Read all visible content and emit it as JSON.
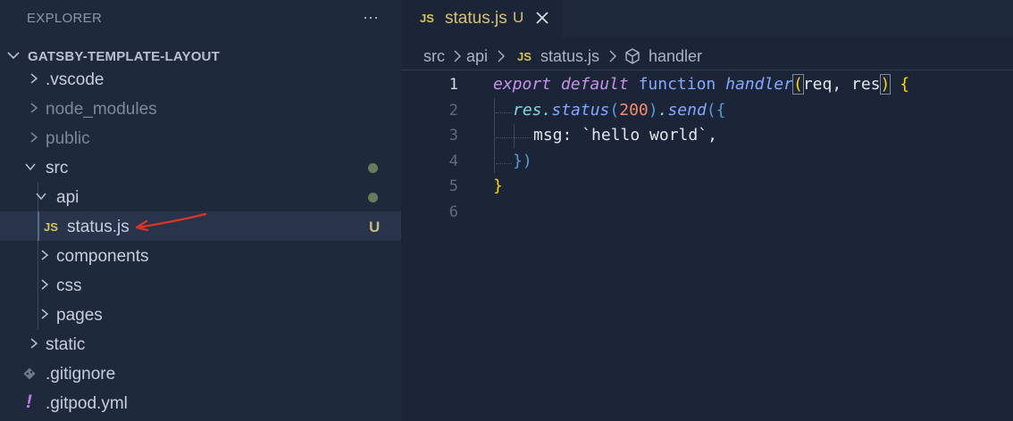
{
  "sidebar": {
    "title": "EXPLORER",
    "more_label": "···",
    "project_name": "GATSBY-TEMPLATE-LAYOUT",
    "items": [
      {
        "label": ".vscode"
      },
      {
        "label": "node_modules"
      },
      {
        "label": "public"
      },
      {
        "label": "src"
      },
      {
        "label": "api"
      },
      {
        "label": "status.js",
        "badge": "U",
        "icon_text": "JS"
      },
      {
        "label": "components"
      },
      {
        "label": "css"
      },
      {
        "label": "pages"
      },
      {
        "label": "static"
      },
      {
        "label": ".gitignore"
      },
      {
        "label": ".gitpod.yml",
        "icon_text": "!"
      }
    ]
  },
  "tab": {
    "icon_text": "JS",
    "title": "status.js",
    "status": "U"
  },
  "breadcrumb": {
    "items": [
      "src",
      "api",
      "status.js",
      "handler"
    ],
    "file_icon_text": "JS"
  },
  "editor": {
    "line_numbers": [
      "1",
      "2",
      "3",
      "4",
      "5",
      "6"
    ],
    "tokens": {
      "l1_export": "export",
      "l1_default": "default",
      "l1_function": "function",
      "l1_name": "handler",
      "l1_open": "(",
      "l1_params": "req, res",
      "l1_close": ")",
      "l1_brace": "{",
      "l2_obj": "res",
      "l2_dot1": ".",
      "l2_status": "status",
      "l2_open1": "(",
      "l2_num": "200",
      "l2_close1": ")",
      "l2_dot2": ".",
      "l2_send": "send",
      "l2_open2": "(",
      "l2_brace": "{",
      "l3_prop": "msg: ",
      "l3_str": "`hello world`",
      "l3_comma": ",",
      "l4_brace": "}",
      "l4_close": ")",
      "l5_brace": "}"
    }
  },
  "colors": {
    "sidebar_bg": "#1e293b",
    "editor_bg": "#1b2537",
    "selected_row": "#273449",
    "js_icon": "#d7c55a",
    "untracked": "#c9b97f",
    "annotation_arrow": "#d9342b"
  }
}
